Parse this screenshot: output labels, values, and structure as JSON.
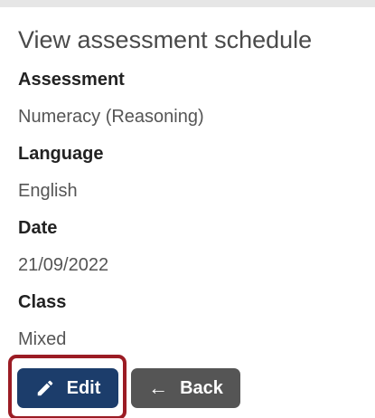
{
  "page": {
    "title": "View assessment schedule"
  },
  "fields": [
    {
      "label": "Assessment",
      "value": "Numeracy (Reasoning)"
    },
    {
      "label": "Language",
      "value": "English"
    },
    {
      "label": "Date",
      "value": "21/09/2022"
    },
    {
      "label": "Class",
      "value": "Mixed"
    }
  ],
  "actions": {
    "edit_label": "Edit",
    "edit_icon": "pencil-icon",
    "back_label": "Back",
    "back_icon": "arrow-left-icon",
    "back_glyph": "←"
  },
  "colors": {
    "edit_button": "#1c3d6b",
    "back_button": "#555555",
    "highlight": "#9b1c24"
  }
}
